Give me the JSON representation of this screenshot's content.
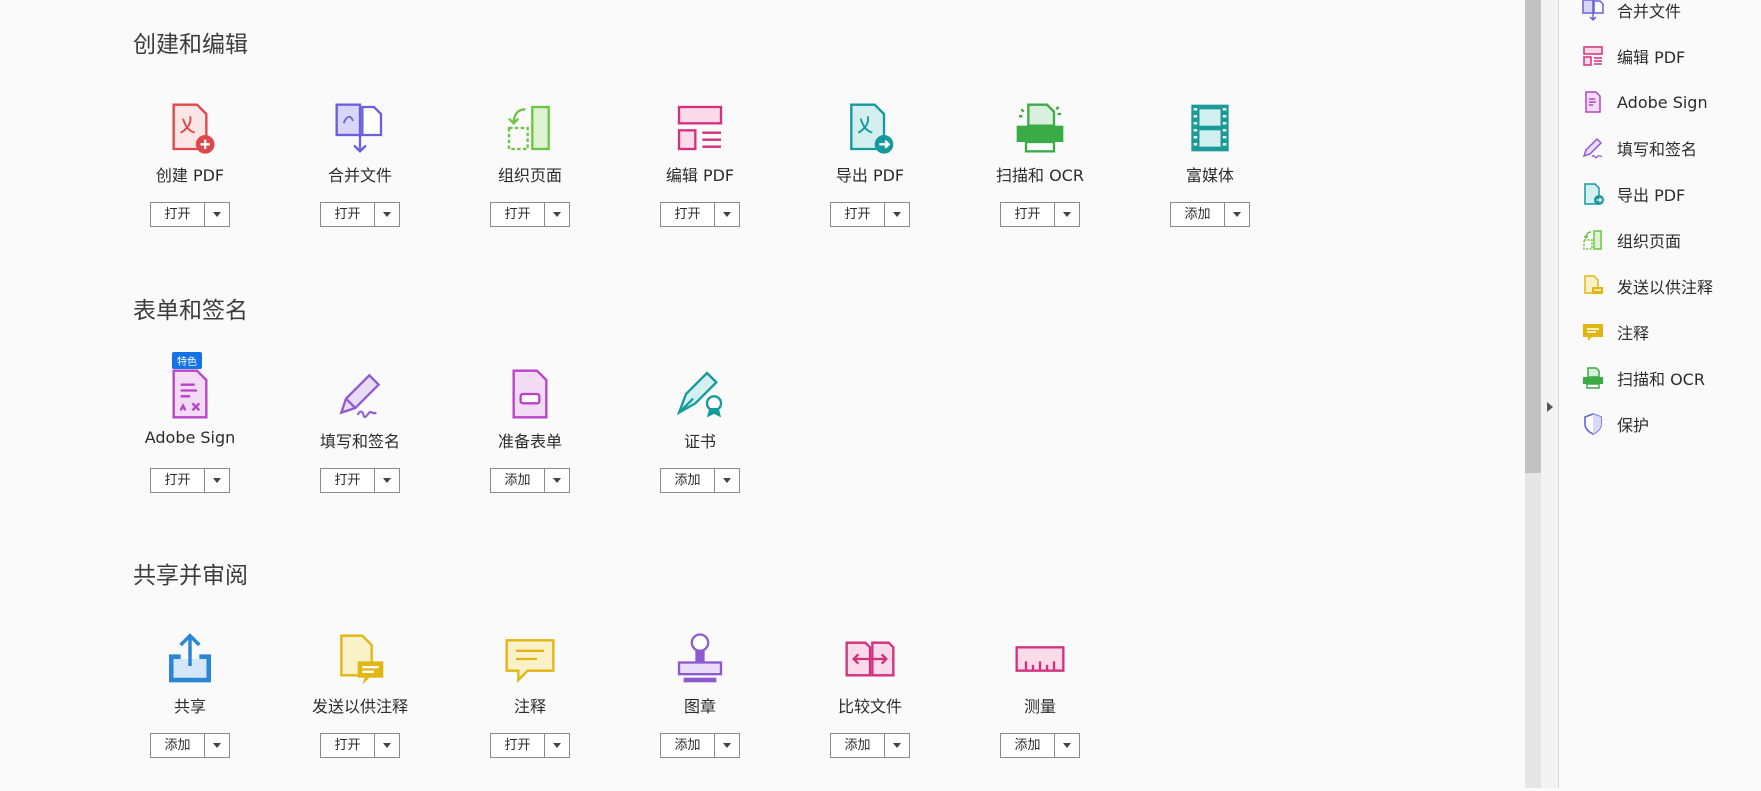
{
  "sections": [
    {
      "title": "创建和编辑",
      "tools": [
        {
          "label": "创建 PDF",
          "action": "打开",
          "icon": "create-pdf-icon"
        },
        {
          "label": "合并文件",
          "action": "打开",
          "icon": "combine-files-icon"
        },
        {
          "label": "组织页面",
          "action": "打开",
          "icon": "organize-pages-icon"
        },
        {
          "label": "编辑 PDF",
          "action": "打开",
          "icon": "edit-pdf-icon"
        },
        {
          "label": "导出 PDF",
          "action": "打开",
          "icon": "export-pdf-icon"
        },
        {
          "label": "扫描和 OCR",
          "action": "打开",
          "icon": "scan-ocr-icon"
        },
        {
          "label": "富媒体",
          "action": "添加",
          "icon": "rich-media-icon"
        }
      ]
    },
    {
      "title": "表单和签名",
      "tools": [
        {
          "label": "Adobe Sign",
          "action": "打开",
          "icon": "adobe-sign-icon",
          "badge": "特色"
        },
        {
          "label": "填写和签名",
          "action": "打开",
          "icon": "fill-sign-icon"
        },
        {
          "label": "准备表单",
          "action": "添加",
          "icon": "prepare-form-icon"
        },
        {
          "label": "证书",
          "action": "添加",
          "icon": "certificates-icon"
        }
      ]
    },
    {
      "title": "共享并审阅",
      "tools": [
        {
          "label": "共享",
          "action": "添加",
          "icon": "share-icon"
        },
        {
          "label": "发送以供注释",
          "action": "打开",
          "icon": "send-comments-icon"
        },
        {
          "label": "注释",
          "action": "打开",
          "icon": "comment-icon"
        },
        {
          "label": "图章",
          "action": "添加",
          "icon": "stamp-icon"
        },
        {
          "label": "比较文件",
          "action": "添加",
          "icon": "compare-files-icon"
        },
        {
          "label": "测量",
          "action": "添加",
          "icon": "measure-icon"
        }
      ]
    }
  ],
  "right_pane": {
    "items": [
      {
        "label": "合并文件",
        "icon": "combine-files-icon"
      },
      {
        "label": "编辑 PDF",
        "icon": "edit-pdf-icon"
      },
      {
        "label": "Adobe Sign",
        "icon": "adobe-sign-icon"
      },
      {
        "label": "填写和签名",
        "icon": "fill-sign-icon"
      },
      {
        "label": "导出 PDF",
        "icon": "export-pdf-icon"
      },
      {
        "label": "组织页面",
        "icon": "organize-pages-icon"
      },
      {
        "label": "发送以供注释",
        "icon": "send-comments-icon"
      },
      {
        "label": "注释",
        "icon": "comment-icon"
      },
      {
        "label": "扫描和 OCR",
        "icon": "scan-ocr-icon"
      },
      {
        "label": "保护",
        "icon": "protect-icon"
      }
    ]
  },
  "colors": {
    "create": "#e0474c",
    "combine": "#6a5fdc",
    "organize": "#6cc644",
    "edit": "#d5307e",
    "export": "#14999d",
    "scan": "#3aab47",
    "media": "#1c9a97",
    "sign": "#b843c7",
    "fill": "#8f5ad3",
    "share": "#2b86d8",
    "send": "#e1b613",
    "stamp": "#8d5bcf",
    "protect": "#5f63d8"
  }
}
